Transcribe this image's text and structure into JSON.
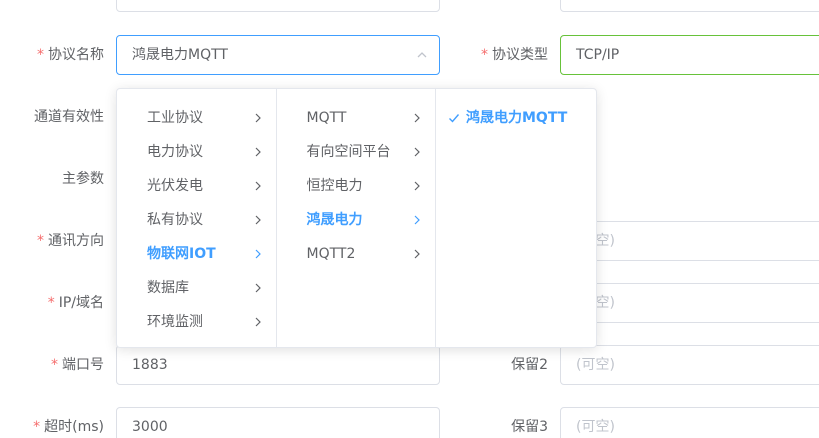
{
  "form": {
    "protocol_name": {
      "label": "协议名称",
      "required": true,
      "value": "鸿晟电力MQTT"
    },
    "protocol_type": {
      "label": "协议类型",
      "required": true,
      "value": "TCP/IP"
    },
    "channel_validity": {
      "label": "通道有效性"
    },
    "main_params": {
      "label": "主参数"
    },
    "comm_direction": {
      "label": "通讯方向",
      "required": true,
      "placeholder": "(可空)"
    },
    "ip_domain": {
      "label": "IP/域名",
      "required": true,
      "placeholder": "(可空)"
    },
    "port": {
      "label": "端口号",
      "required": true,
      "value": "1883"
    },
    "reserve2": {
      "label": "保留2",
      "placeholder": "(可空)"
    },
    "timeout": {
      "label": "超时(ms)",
      "required": true,
      "value": "3000"
    },
    "reserve3": {
      "label": "保留3",
      "placeholder": "(可空)"
    }
  },
  "cascader": {
    "level1": [
      {
        "label": "工业协议",
        "active": false
      },
      {
        "label": "电力协议",
        "active": false
      },
      {
        "label": "光伏发电",
        "active": false
      },
      {
        "label": "私有协议",
        "active": false
      },
      {
        "label": "物联网IOT",
        "active": true
      },
      {
        "label": "数据库",
        "active": false
      },
      {
        "label": "环境监测",
        "active": false
      }
    ],
    "level2": [
      {
        "label": "MQTT",
        "active": false
      },
      {
        "label": "有向空间平台",
        "active": false
      },
      {
        "label": "恒控电力",
        "active": false
      },
      {
        "label": "鸿晟电力",
        "active": true
      },
      {
        "label": "MQTT2",
        "active": false
      }
    ],
    "level3": [
      {
        "label": "鸿晟电力MQTT",
        "active": true,
        "checked": true
      }
    ]
  },
  "colors": {
    "primary": "#409eff",
    "success": "#67c23a",
    "required": "#f56c6c"
  }
}
